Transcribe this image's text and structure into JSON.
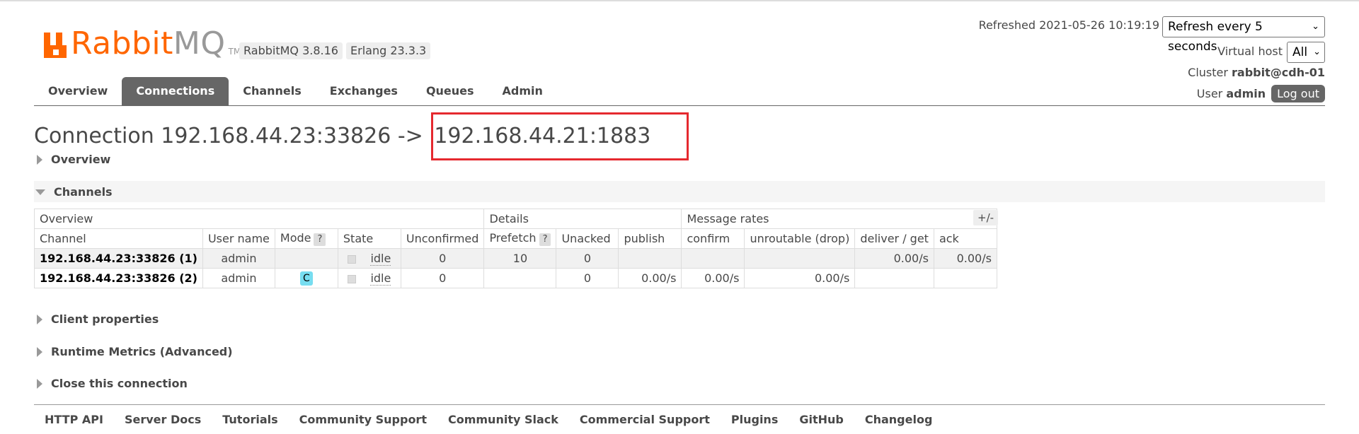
{
  "logo": {
    "brand_a": "Rabbit",
    "brand_b": "MQ",
    "tm": "TM"
  },
  "versions": {
    "rabbitmq": "RabbitMQ 3.8.16",
    "erlang": "Erlang 23.3.3"
  },
  "header": {
    "refreshed": "Refreshed 2021-05-26 10:19:19",
    "refresh_select": "Refresh every 5 seconds",
    "virtual_host_label": "Virtual host",
    "virtual_host_select": "All",
    "cluster_label": "Cluster",
    "cluster_value": "rabbit@cdh-01",
    "user_label": "User",
    "user_value": "admin",
    "logout": "Log out"
  },
  "tabs": [
    {
      "label": "Overview",
      "active": false
    },
    {
      "label": "Connections",
      "active": true
    },
    {
      "label": "Channels",
      "active": false
    },
    {
      "label": "Exchanges",
      "active": false
    },
    {
      "label": "Queues",
      "active": false
    },
    {
      "label": "Admin",
      "active": false
    }
  ],
  "page": {
    "title_prefix": "Connection 192.168.44.23:33826 -> ",
    "title_target": "192.168.44.21:1883",
    "highlight_color": "#e5292f"
  },
  "sections": {
    "overview": "Overview",
    "channels": "Channels",
    "client_properties": "Client properties",
    "runtime_metrics": "Runtime Metrics (Advanced)",
    "close_connection": "Close this connection"
  },
  "channels_table": {
    "group_headers": [
      "Overview",
      "Details",
      "Message rates"
    ],
    "columns": [
      "Channel",
      "User name",
      "Mode",
      "State",
      "Unconfirmed",
      "Prefetch",
      "Unacked",
      "publish",
      "confirm",
      "unroutable (drop)",
      "deliver / get",
      "ack"
    ],
    "help": "?",
    "plus_minus": "+/-",
    "rows": [
      {
        "channel": "192.168.44.23:33826 (1)",
        "user": "admin",
        "mode": "",
        "state": "idle",
        "unconfirmed": "0",
        "prefetch": "10",
        "unacked": "0",
        "publish": "",
        "confirm": "",
        "unroutable": "",
        "deliver_get": "0.00/s",
        "ack": "0.00/s"
      },
      {
        "channel": "192.168.44.23:33826 (2)",
        "user": "admin",
        "mode": "C",
        "state": "idle",
        "unconfirmed": "0",
        "prefetch": "",
        "unacked": "0",
        "publish": "0.00/s",
        "confirm": "0.00/s",
        "unroutable": "0.00/s",
        "deliver_get": "",
        "ack": ""
      }
    ]
  },
  "footer": [
    "HTTP API",
    "Server Docs",
    "Tutorials",
    "Community Support",
    "Community Slack",
    "Commercial Support",
    "Plugins",
    "GitHub",
    "Changelog"
  ],
  "colors": {
    "accent": "#ff6600",
    "tab_active": "#666666"
  }
}
